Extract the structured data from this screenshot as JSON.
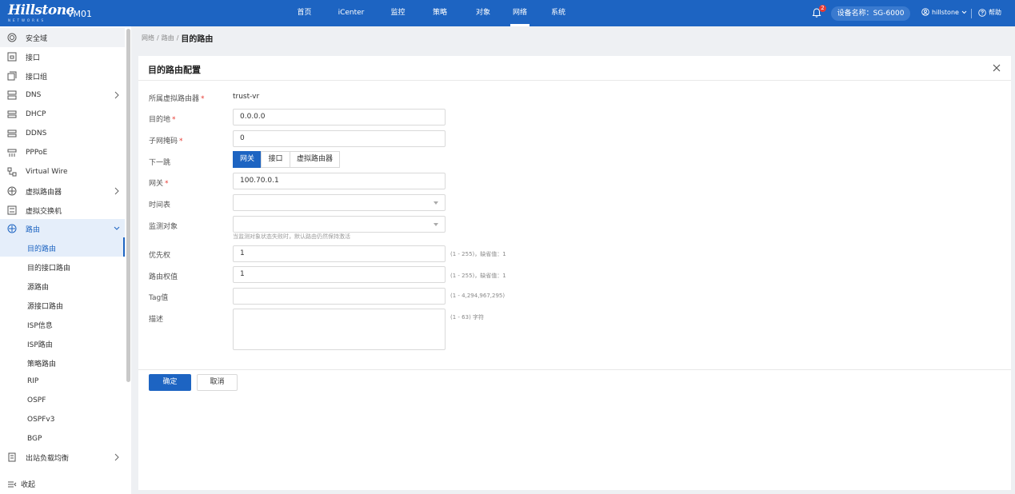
{
  "header": {
    "logo_text": "Hillstone",
    "logo_subtext": "NETWORKS",
    "device_short_name": "VM01",
    "nav": [
      "首页",
      "iCenter",
      "监控",
      "策略",
      "对象",
      "网络",
      "系统"
    ],
    "active_nav": "网络",
    "notification_count": "2",
    "device_name_pill": "设备名称：SG-6000",
    "user_name": "hillstone",
    "help_label": "帮助"
  },
  "sidebar": {
    "items": [
      {
        "label": "安全域",
        "icon": "security-zone-icon"
      },
      {
        "label": "接口",
        "icon": "interface-icon"
      },
      {
        "label": "接口组",
        "icon": "interface-group-icon"
      },
      {
        "label": "DNS",
        "icon": "dns-icon"
      },
      {
        "label": "DHCP",
        "icon": "dhcp-icon"
      },
      {
        "label": "DDNS",
        "icon": "ddns-icon"
      },
      {
        "label": "PPPoE",
        "icon": "pppoe-icon"
      },
      {
        "label": "Virtual Wire",
        "icon": "virtual-wire-icon"
      },
      {
        "label": "虚拟路由器",
        "icon": "virtual-router-icon"
      },
      {
        "label": "虚拟交换机",
        "icon": "virtual-switch-icon"
      },
      {
        "label": "路由",
        "icon": "routing-icon"
      }
    ],
    "routing_sub": [
      "目的路由",
      "目的接口路由",
      "源路由",
      "源接口路由",
      "ISP信息",
      "ISP路由",
      "策略路由",
      "RIP",
      "OSPF",
      "OSPFv3",
      "BGP"
    ],
    "after_items": [
      {
        "label": "出站负载均衡",
        "icon": "outbound-lb-icon"
      }
    ],
    "collapse_label": "收起"
  },
  "breadcrumb": {
    "part1": "网络",
    "sep": "/",
    "part2": "路由",
    "current": "目的路由"
  },
  "form": {
    "title": "目的路由配置",
    "vrouter_label": "所属虚拟路由器",
    "vrouter_value": "trust-vr",
    "dest_label": "目的地",
    "dest_value": "0.0.0.0",
    "mask_label": "子网掩码",
    "mask_value": "0",
    "nexthop_label": "下一跳",
    "nexthop_options": [
      "网关",
      "接口",
      "虚拟路由器"
    ],
    "nexthop_selected": "网关",
    "gateway_label": "网关",
    "gateway_value": "100.70.0.1",
    "schedule_label": "时间表",
    "schedule_value": "",
    "monitor_label": "监测对象",
    "monitor_value": "",
    "monitor_note": "当监测对象状态失败时，默认路由仍然保持激活",
    "priority_label": "优先权",
    "priority_value": "1",
    "priority_hint": "(1 - 255)，缺省值：1",
    "weight_label": "路由权值",
    "weight_value": "1",
    "weight_hint": "(1 - 255)，缺省值：1",
    "tag_label": "Tag值",
    "tag_value": "",
    "tag_hint": "(1 - 4,294,967,295)",
    "desc_label": "描述",
    "desc_value": "",
    "desc_hint": "(1 - 63) 字符",
    "ok_label": "确定",
    "cancel_label": "取消"
  }
}
